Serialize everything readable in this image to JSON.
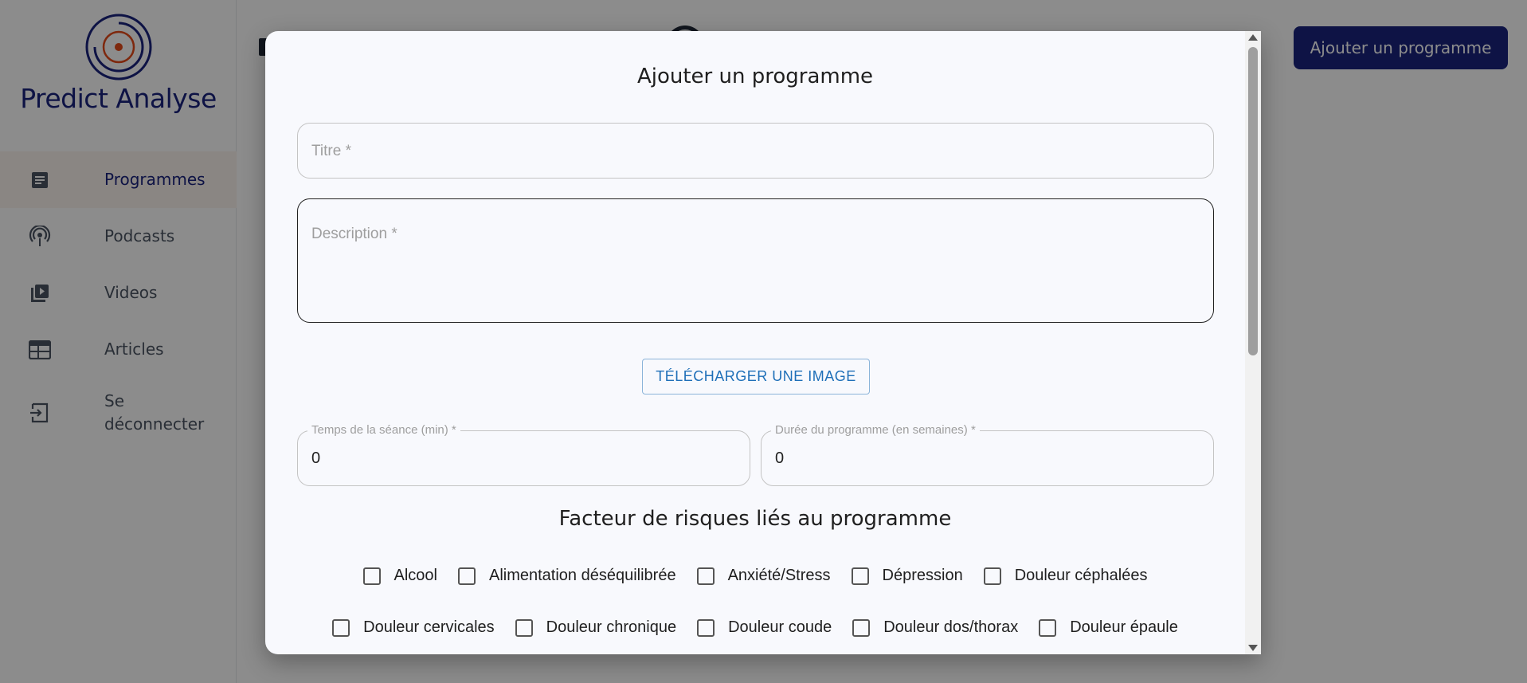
{
  "app": {
    "name": "Predict Analyse"
  },
  "sidebar": {
    "items": [
      {
        "label": "Programmes",
        "icon": "article-icon",
        "active": true
      },
      {
        "label": "Podcasts",
        "icon": "podcast-icon",
        "active": false
      },
      {
        "label": "Videos",
        "icon": "video-library-icon",
        "active": false
      },
      {
        "label": "Articles",
        "icon": "table-icon",
        "active": false
      },
      {
        "label": "Se\ndéconnecter",
        "icon": "logout-icon",
        "active": false
      }
    ]
  },
  "header": {
    "add_button_label": "Ajouter un programme"
  },
  "modal": {
    "title": "Ajouter un programme",
    "title_field": {
      "placeholder": "Titre *",
      "value": ""
    },
    "description_field": {
      "placeholder": "Description *",
      "value": ""
    },
    "upload_button_label": "TÉLÉCHARGER UNE IMAGE",
    "session_time": {
      "label": "Temps de la séance (min) *",
      "value": "0"
    },
    "program_duration": {
      "label": "Durée du programme (en semaines) *",
      "value": "0"
    },
    "risk_section_title": "Facteur de risques liés au programme",
    "risk_factors_row1": [
      "Alcool",
      "Alimentation déséquilibrée",
      "Anxiété/Stress",
      "Dépression",
      "Douleur céphalées"
    ],
    "risk_factors_row2": [
      "Douleur cervicales",
      "Douleur chronique",
      "Douleur coude",
      "Douleur dos/thorax",
      "Douleur épaule"
    ]
  },
  "colors": {
    "brand": "#1a237e",
    "accent": "#e64a19",
    "link": "#1e6fb8"
  }
}
